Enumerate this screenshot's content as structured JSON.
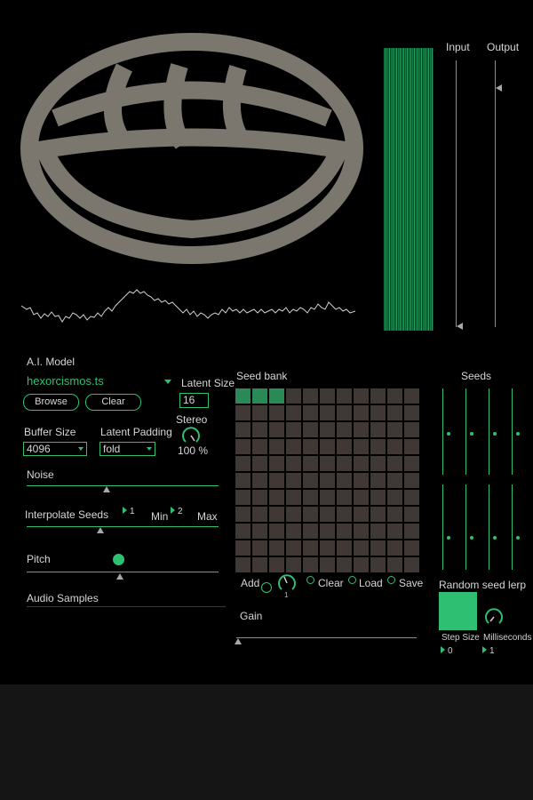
{
  "colors": {
    "accent": "#2fbf73",
    "background": "#000000",
    "logo": "#7b776e",
    "grid_cell": "#3f3835",
    "grid_cell_active": "#2a8a55"
  },
  "meters": {
    "input_label": "Input",
    "output_label": "Output"
  },
  "model": {
    "section_label": "A.I. Model",
    "file_name": "hexorcismos.ts",
    "browse_label": "Browse",
    "clear_label": "Clear"
  },
  "latent_size": {
    "label": "Latent Size",
    "value": "16"
  },
  "buffer_size": {
    "label": "Buffer Size",
    "value": "4096"
  },
  "latent_padding": {
    "label": "Latent Padding",
    "value": "fold"
  },
  "stereo": {
    "label": "Stereo",
    "value": "100 %",
    "level": 1.0
  },
  "noise": {
    "label": "Noise",
    "level": 0.43
  },
  "interpolate": {
    "label": "Interpolate Seeds",
    "seed1": "1",
    "min_label": "Min",
    "seed2": "2",
    "max_label": "Max",
    "level": 0.38
  },
  "pitch": {
    "label": "Pitch",
    "level": 0.47
  },
  "audio_samples": {
    "label": "Audio Samples"
  },
  "seed_bank": {
    "label": "Seed bank",
    "rows": 11,
    "cols": 11,
    "active_cells": [
      0,
      1,
      2
    ],
    "add_label": "Add",
    "add_value": "1",
    "clear_label": "Clear",
    "load_label": "Load",
    "save_label": "Save"
  },
  "gain": {
    "label": "Gain",
    "level": 0.0
  },
  "seeds": {
    "label": "Seeds",
    "levels": [
      0.5,
      0.5,
      0.5,
      0.5,
      0.4,
      0.4,
      0.4,
      0.4
    ]
  },
  "random_lerp": {
    "label": "Random seed lerp",
    "step_size_label": "Step Size",
    "step_size_value": "0",
    "milliseconds_label": "Milliseconds",
    "milliseconds_value": "1"
  },
  "icons": {
    "dropdown": "chevron-down-icon",
    "number_arrow": "triangle-right-icon"
  }
}
